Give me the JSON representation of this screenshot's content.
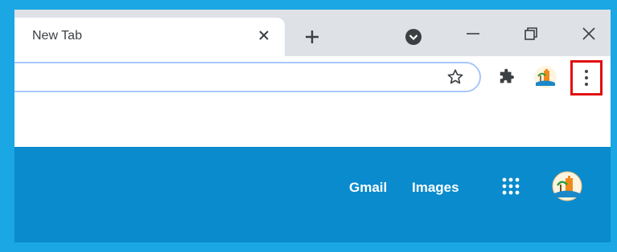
{
  "tab": {
    "title": "New Tab"
  },
  "page": {
    "links": {
      "gmail": "Gmail",
      "images": "Images"
    }
  },
  "colors": {
    "frame": "#1aa7e4",
    "tabstrip": "#dee1e6",
    "page_band": "#0a8bcd",
    "highlight": "#e01010"
  },
  "icons": {
    "tab_close": "close-icon",
    "new_tab": "plus-icon",
    "tab_search": "tab-search-icon",
    "minimize": "minimize-icon",
    "restore": "restore-icon",
    "close_window": "close-icon",
    "bookmark": "star-icon",
    "extensions": "puzzle-icon",
    "profile": "avatar",
    "menu": "three-dot-menu-icon",
    "apps": "grid-icon"
  }
}
